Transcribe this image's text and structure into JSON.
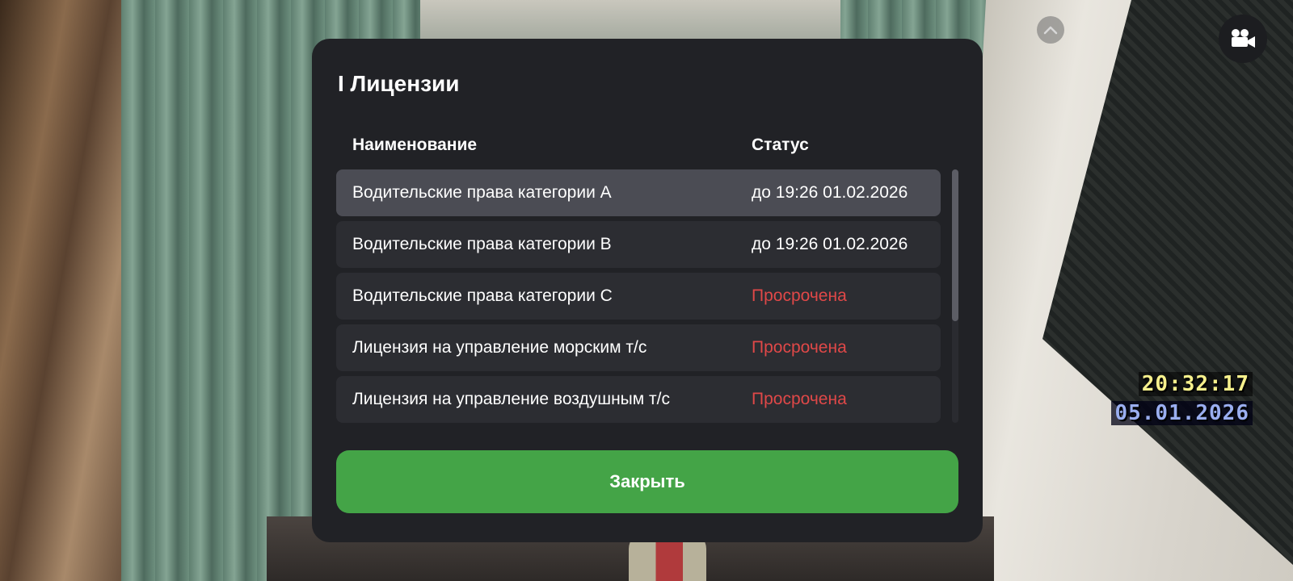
{
  "dialog": {
    "title": "I Лицензии",
    "columns": {
      "name": "Наименование",
      "status": "Статус"
    },
    "rows": [
      {
        "name": "Водительские права категории А",
        "status": "до 19:26 01.02.2026",
        "expired": false,
        "selected": true
      },
      {
        "name": "Водительские права категории B",
        "status": "до 19:26 01.02.2026",
        "expired": false,
        "selected": false
      },
      {
        "name": "Водительские права категории C",
        "status": "Просрочена",
        "expired": true,
        "selected": false
      },
      {
        "name": "Лицензия на управление морским т/с",
        "status": "Просрочена",
        "expired": true,
        "selected": false
      },
      {
        "name": "Лицензия на управление воздушным т/с",
        "status": "Просрочена",
        "expired": true,
        "selected": false
      }
    ],
    "close_label": "Закрыть"
  },
  "hud": {
    "time": "20:32:17",
    "date": "05.01.2026",
    "icons": {
      "collapse": "chevron-up-icon",
      "camera": "video-camera-icon"
    }
  },
  "colors": {
    "dialog_bg": "#212226",
    "row_bg": "#2c2d32",
    "row_selected_bg": "#4b4c54",
    "expired": "#e04848",
    "button": "#44a447"
  }
}
